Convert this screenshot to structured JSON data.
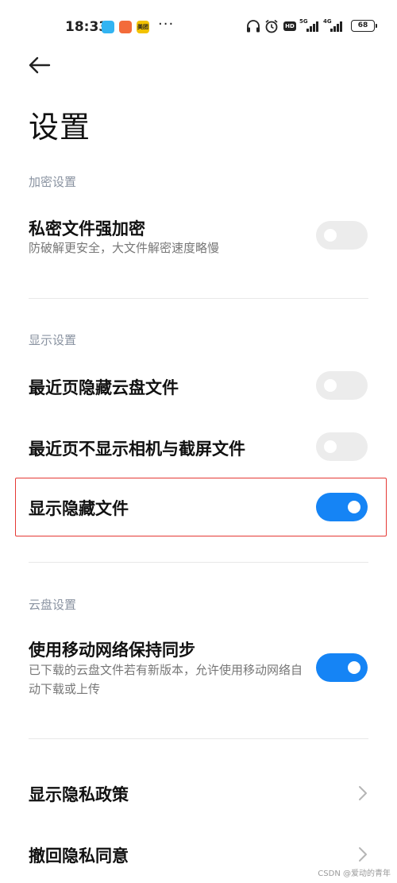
{
  "status_bar": {
    "time": "18:33",
    "app_c_label": "美团",
    "more": "···",
    "net_5g": "5G",
    "net_4g": "4G",
    "hd": "HD",
    "battery": "68"
  },
  "header": {
    "title": "设置"
  },
  "sections": {
    "encryption": {
      "header": "加密设置",
      "items": [
        {
          "title": "私密文件强加密",
          "subtitle": "防破解更安全，大文件解密速度略慢",
          "enabled": false
        }
      ]
    },
    "display": {
      "header": "显示设置",
      "items": [
        {
          "title": "最近页隐藏云盘文件",
          "enabled": false
        },
        {
          "title": "最近页不显示相机与截屏文件",
          "enabled": false
        },
        {
          "title": "显示隐藏文件",
          "enabled": true
        }
      ]
    },
    "cloud": {
      "header": "云盘设置",
      "items": [
        {
          "title": "使用移动网络保持同步",
          "subtitle": "已下载的云盘文件若有新版本，允许使用移动网络自动下载或上传",
          "enabled": true
        }
      ]
    },
    "privacy": {
      "items": [
        {
          "title": "显示隐私政策"
        },
        {
          "title": "撤回隐私同意"
        }
      ]
    }
  },
  "watermark": "CSDN @爱动的青年",
  "colors": {
    "accent": "#1584f5",
    "toggle_off": "#ececec",
    "highlight": "#e53935",
    "section_header": "#8a93a1"
  }
}
